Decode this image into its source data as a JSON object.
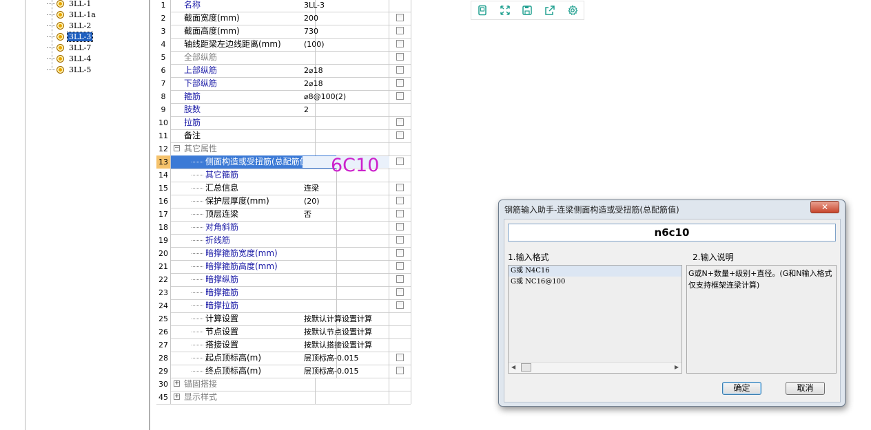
{
  "tree": {
    "items": [
      {
        "label": "3LL-1",
        "selected": false
      },
      {
        "label": "3LL-1a",
        "selected": false
      },
      {
        "label": "3LL-2",
        "selected": false
      },
      {
        "label": "3LL-3",
        "selected": true
      },
      {
        "label": "3LL-7",
        "selected": false
      },
      {
        "label": "3LL-4",
        "selected": false
      },
      {
        "label": "3LL-5",
        "selected": false
      }
    ]
  },
  "grid": {
    "rows": [
      {
        "num": "1",
        "name": "名称",
        "value": "3LL-3",
        "check": false,
        "style": "blue",
        "indent": 0
      },
      {
        "num": "2",
        "name": "截面宽度(mm)",
        "value": "200",
        "check": true,
        "style": "black",
        "indent": 0
      },
      {
        "num": "3",
        "name": "截面高度(mm)",
        "value": "730",
        "check": true,
        "style": "black",
        "indent": 0
      },
      {
        "num": "4",
        "name": "轴线距梁左边线距离(mm)",
        "value": "(100)",
        "check": true,
        "style": "black",
        "indent": 0
      },
      {
        "num": "5",
        "name": "全部纵筋",
        "value": "",
        "check": true,
        "style": "gray",
        "indent": 0
      },
      {
        "num": "6",
        "name": "上部纵筋",
        "value": "2⌀18",
        "check": true,
        "style": "blue",
        "indent": 0
      },
      {
        "num": "7",
        "name": "下部纵筋",
        "value": "2⌀18",
        "check": true,
        "style": "blue",
        "indent": 0
      },
      {
        "num": "8",
        "name": "箍筋",
        "value": "⌀8@100(2)",
        "check": true,
        "style": "blue",
        "indent": 0
      },
      {
        "num": "9",
        "name": "肢数",
        "value": "2",
        "check": false,
        "style": "blue",
        "indent": 0
      },
      {
        "num": "10",
        "name": "拉筋",
        "value": "",
        "check": true,
        "style": "blue",
        "indent": 0
      },
      {
        "num": "11",
        "name": "备注",
        "value": "",
        "check": true,
        "style": "black",
        "indent": 0
      },
      {
        "num": "12",
        "name": "其它属性",
        "value": "",
        "check": false,
        "style": "gray",
        "indent": 0,
        "expander": "−"
      },
      {
        "num": "13",
        "name": "侧面构造或受扭筋(总配筋值)",
        "value": "",
        "check": true,
        "style": "blue",
        "indent": 1,
        "active": true
      },
      {
        "num": "14",
        "name": "其它箍筋",
        "value": "",
        "check": false,
        "style": "blue",
        "indent": 1
      },
      {
        "num": "15",
        "name": "汇总信息",
        "value": "连梁",
        "check": true,
        "style": "black",
        "indent": 1
      },
      {
        "num": "16",
        "name": "保护层厚度(mm)",
        "value": "(20)",
        "check": true,
        "style": "black",
        "indent": 1
      },
      {
        "num": "17",
        "name": "顶层连梁",
        "value": "否",
        "check": true,
        "style": "black",
        "indent": 1
      },
      {
        "num": "18",
        "name": "对角斜筋",
        "value": "",
        "check": true,
        "style": "blue",
        "indent": 1
      },
      {
        "num": "19",
        "name": "折线筋",
        "value": "",
        "check": true,
        "style": "blue",
        "indent": 1
      },
      {
        "num": "20",
        "name": "暗撑箍筋宽度(mm)",
        "value": "",
        "check": true,
        "style": "blue",
        "indent": 1
      },
      {
        "num": "21",
        "name": "暗撑箍筋高度(mm)",
        "value": "",
        "check": true,
        "style": "blue",
        "indent": 1
      },
      {
        "num": "22",
        "name": "暗撑纵筋",
        "value": "",
        "check": true,
        "style": "blue",
        "indent": 1
      },
      {
        "num": "23",
        "name": "暗撑箍筋",
        "value": "",
        "check": true,
        "style": "blue",
        "indent": 1
      },
      {
        "num": "24",
        "name": "暗撑拉筋",
        "value": "",
        "check": true,
        "style": "blue",
        "indent": 1
      },
      {
        "num": "25",
        "name": "计算设置",
        "value": "按默认计算设置计算",
        "check": false,
        "style": "black",
        "indent": 1
      },
      {
        "num": "26",
        "name": "节点设置",
        "value": "按默认节点设置计算",
        "check": false,
        "style": "black",
        "indent": 1
      },
      {
        "num": "27",
        "name": "搭接设置",
        "value": "按默认搭接设置计算",
        "check": false,
        "style": "black",
        "indent": 1
      },
      {
        "num": "28",
        "name": "起点顶标高(m)",
        "value": "层顶标高-0.015",
        "check": true,
        "style": "black",
        "indent": 1
      },
      {
        "num": "29",
        "name": "终点顶标高(m)",
        "value": "层顶标高-0.015",
        "check": true,
        "style": "black",
        "indent": 1
      },
      {
        "num": "30",
        "name": "锚固搭接",
        "value": "",
        "check": false,
        "style": "gray",
        "indent": 0,
        "expander": "+"
      },
      {
        "num": "45",
        "name": "显示样式",
        "value": "",
        "check": false,
        "style": "gray",
        "indent": 0,
        "expander": "+"
      }
    ],
    "overlay_text": "6C10"
  },
  "toolbar": {
    "icons": [
      "page-icon",
      "fullscreen-icon",
      "save-icon",
      "share-icon",
      "settings-icon"
    ]
  },
  "dialog": {
    "title": "钢筋输入助手-连梁侧面构造或受扭筋(总配筋值)",
    "close": "✕",
    "input_value": "n6c10",
    "format_label": "1.输入格式",
    "desc_label": "2.输入说明",
    "formats": [
      "G或 N4C16",
      "G或 NC16@100"
    ],
    "description": "G或N+数量+级别+直径。(G和N输入格式仅支持框架连梁计算)",
    "ok": "确定",
    "cancel": "取消"
  },
  "colors": {
    "selection": "#3c7ad6",
    "active_num": "#f5c26b",
    "blue_text": "#1a1aa6",
    "overlay": "#cc22cc",
    "toolbar_icon": "#20a090"
  }
}
